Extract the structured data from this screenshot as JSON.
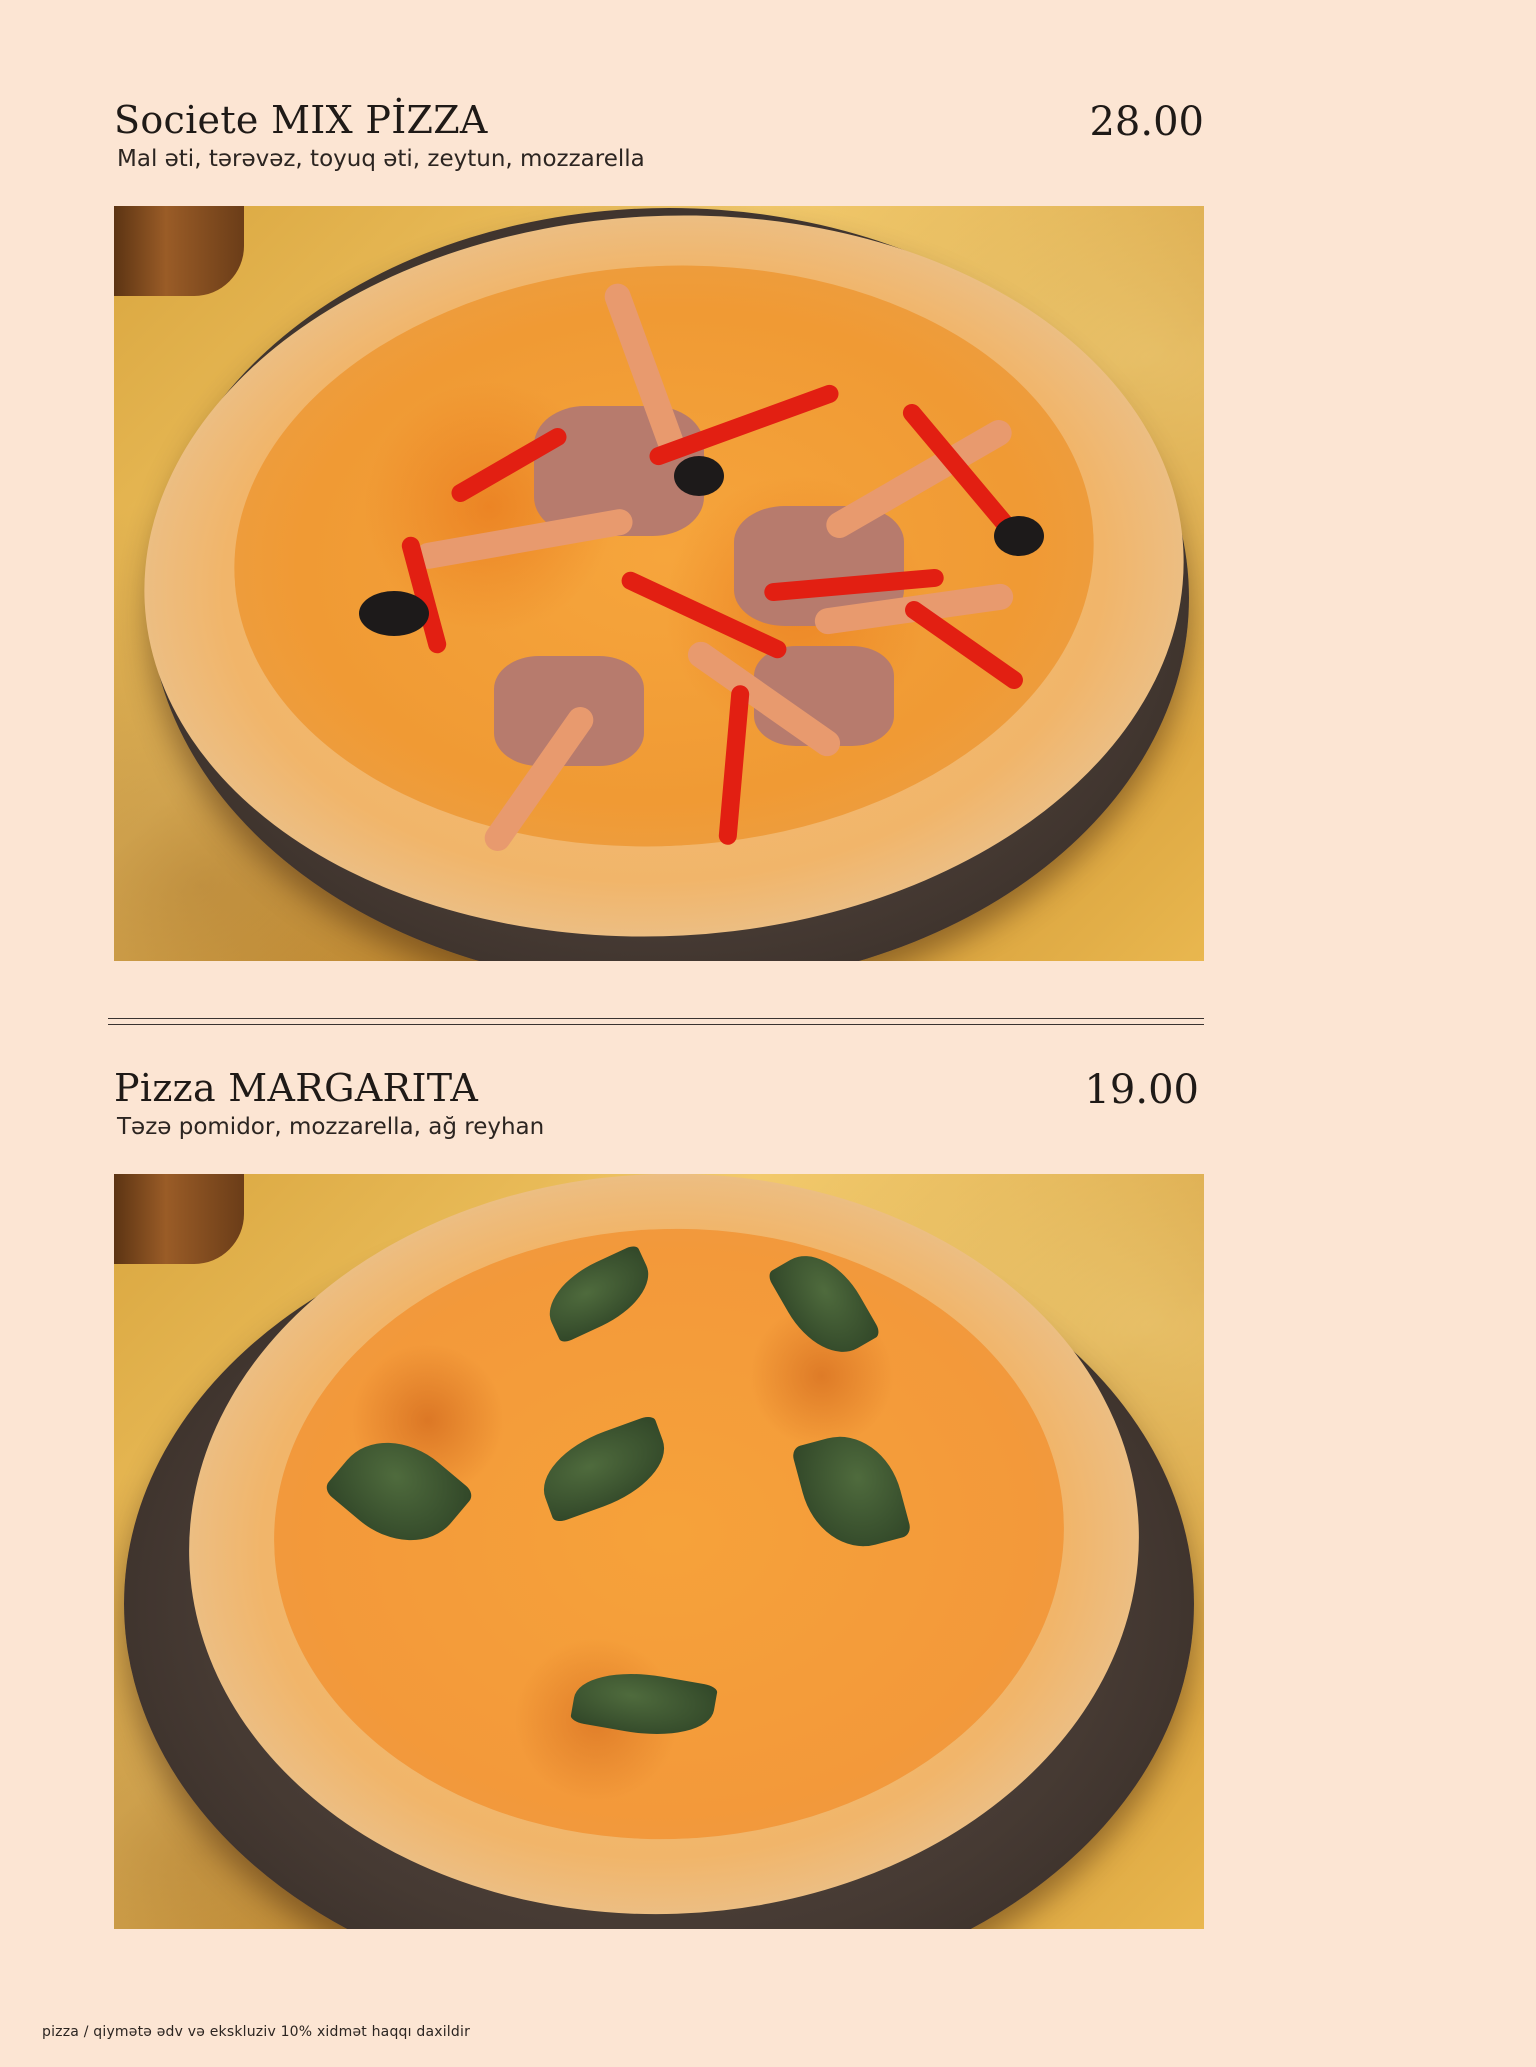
{
  "items": [
    {
      "title": "Societe MIX PİZZA",
      "price": "28.00",
      "description": "Mal əti, tərəvəz, toyuq əti, zeytun, mozzarella"
    },
    {
      "title": "Pizza MARGARITA",
      "price": "19.00",
      "description": "Təzə pomidor, mozzarella, ağ reyhan"
    }
  ],
  "footer": {
    "note": "pizza / qiymətə ədv və ekskluziv 10% xidmət haqqı daxildir"
  },
  "colors": {
    "background": "#fce5d3",
    "text": "#1f1a17"
  }
}
